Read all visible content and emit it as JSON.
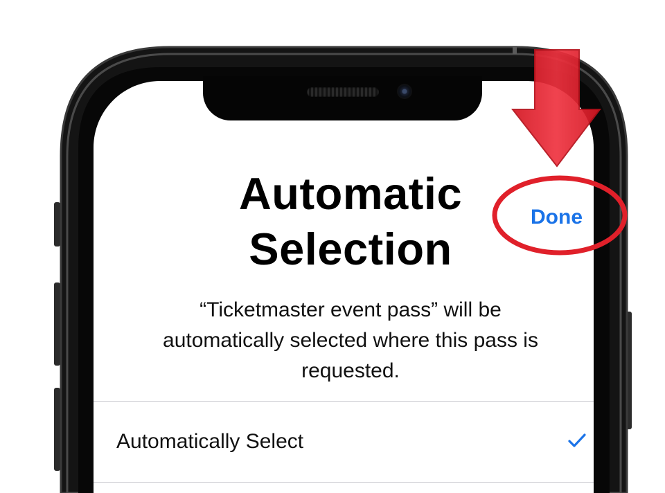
{
  "dialog": {
    "title_line1": "Automatic",
    "title_line2": "Selection",
    "done_label": "Done",
    "description_line1": "“Ticketmaster event pass” will be",
    "description_line2": "automatically selected where this pass is",
    "description_line3": "requested."
  },
  "options": [
    {
      "label": "Automatically Select",
      "selected": true,
      "check_icon": "checkmark-icon"
    }
  ],
  "icons": {
    "checkmark": "checkmark-icon",
    "annotation_arrow": "down-arrow-icon",
    "annotation_circle": "highlight-ellipse"
  },
  "colors": {
    "accent_blue": "#1a73e8",
    "annotation_red": "#e0202a",
    "device_frame": "#1c1c1c"
  }
}
